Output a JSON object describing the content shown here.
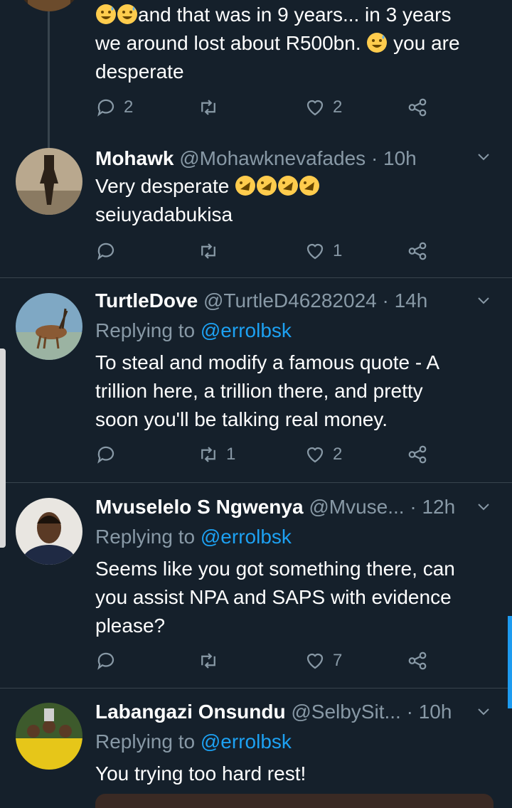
{
  "tweet0": {
    "line1": "and that was in 9 years... in 3 years",
    "line2": "we around lost about R500bn.",
    "line2b": "you are",
    "line3": "desperate",
    "replies": "2",
    "likes": "2"
  },
  "tweet1": {
    "name": "Mohawk",
    "handle": "@Mohawknevafades",
    "time": "· 10h",
    "line1": "Very desperate",
    "line2": "seiuyadabukisa",
    "likes": "1"
  },
  "tweet2": {
    "name": "TurtleDove",
    "handle": "@TurtleD46282024",
    "time": "· 14h",
    "replying_prefix": "Replying to",
    "replying_to": "@errolbsk",
    "line1": "To steal and modify a famous quote - A",
    "line2": "trillion here, a trillion there, and pretty",
    "line3": "soon you'll be talking real money.",
    "retweets": "1",
    "likes": "2"
  },
  "tweet3": {
    "name": "Mvuselelo S Ngwenya",
    "handle": "@Mvuse...",
    "time": "· 12h",
    "replying_prefix": "Replying to",
    "replying_to": "@errolbsk",
    "line1": "Seems like you got something there, can",
    "line2": "you assist NPA and SAPS with evidence",
    "line3": "please?",
    "likes": "7"
  },
  "tweet4": {
    "name": "Labangazi Onsundu",
    "handle": "@SelbySit...",
    "time": "· 10h",
    "replying_prefix": "Replying to",
    "replying_to": "@errolbsk",
    "line1": "You trying too hard rest!"
  },
  "colors": {
    "background": "#15202b",
    "muted": "#8899a6",
    "link": "#1da1f2",
    "divider": "#38444d"
  },
  "icons": [
    "reply-icon",
    "retweet-icon",
    "like-icon",
    "share-icon",
    "chevron-down-icon"
  ]
}
